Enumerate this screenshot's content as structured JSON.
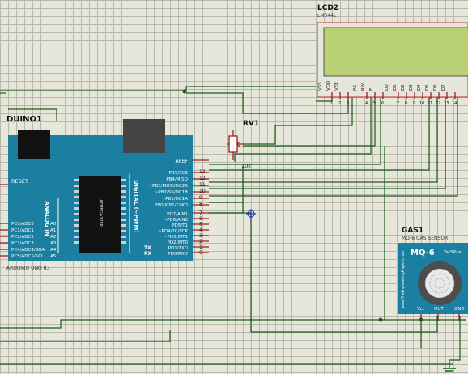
{
  "arduino": {
    "ref": "DUINO1",
    "model": "ARDUINO UNO R3",
    "reset": "RESET",
    "analog_title": "ANALOG IN",
    "digital_title": "DIGITAL (~PWM)",
    "chip_text": "ATMEGA328P",
    "left_pins": [
      "PC0/ADC0",
      "PC1/ADC1",
      "PC2/ADC2",
      "PC3/ADC3",
      "PC4/ADC4/SDA",
      "PC5/ADC5/SCL"
    ],
    "left_nums": [
      "A0",
      "A1",
      "A2",
      "A3",
      "A4",
      "A5"
    ],
    "aref": "AREF",
    "right_pins_top": [
      "PB5/SCK",
      "PB4/MISO",
      "~PB3/MOSI/OC2A",
      "~PB2/SS/OC1B",
      "~PB1/OC1A",
      "PB0/ICP1/CLKO"
    ],
    "right_nums_top": [
      "13",
      "12",
      "11",
      "10",
      "9",
      "8"
    ],
    "right_pins_bottom": [
      "PD7/AIN1",
      "~PD6/AIN0",
      "PD5/T1",
      "~PD4/T0/XCK",
      "~PD3/INT1",
      "PD2/INT0",
      "PD1/TXD",
      "PD0/RXD"
    ],
    "right_nums_bottom": [
      "7",
      "6",
      "5",
      "4",
      "3",
      "2",
      "1",
      "0"
    ],
    "tx": "TX",
    "rx": "RX"
  },
  "lcd": {
    "ref": "LCD2",
    "model": "LM044L",
    "pins": [
      "VSS",
      "VDD",
      "VEE",
      "RS",
      "RW",
      "E",
      "D0",
      "D1",
      "D2",
      "D3",
      "D4",
      "D5",
      "D6",
      "D7"
    ],
    "pin_nums": [
      "1",
      "2",
      "3",
      "4",
      "5",
      "6",
      "7",
      "8",
      "9",
      "10",
      "11",
      "12",
      "13",
      "14"
    ]
  },
  "pot": {
    "ref": "RV1",
    "value": "10k"
  },
  "gas": {
    "ref": "GAS1",
    "model": "MQ-6 GAS SENSOR",
    "title": "MQ-6",
    "brand": "TecSPlus",
    "side_text": "www.TheEngineeringProjects.com",
    "pins": [
      "Vcc",
      "OUT",
      "GND"
    ]
  },
  "colors": {
    "board": "#1a7fa0",
    "wire": "#1a5c1a",
    "lcd_screen": "#b9d074",
    "lcd_frame": "#c33232",
    "grid_bg": "#e6e6da",
    "pin_red": "#9b1f1f"
  }
}
